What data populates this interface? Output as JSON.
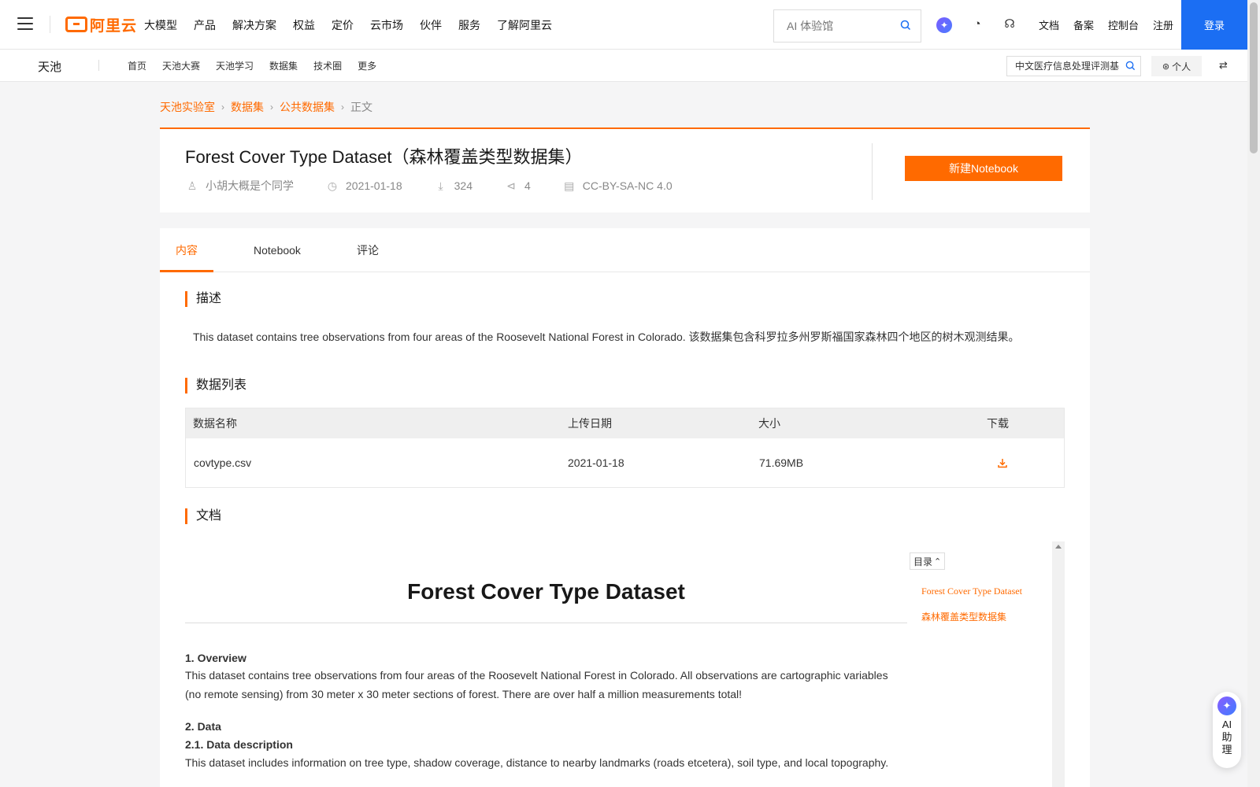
{
  "topnav": {
    "logo_text": "阿里云",
    "items": [
      "大模型",
      "产品",
      "解决方案",
      "权益",
      "定价",
      "云市场",
      "伙伴",
      "服务",
      "了解阿里云"
    ],
    "search_placeholder": "AI 体验馆",
    "util_links": [
      "文档",
      "备案",
      "控制台",
      "注册"
    ],
    "login_label": "登录"
  },
  "subnav": {
    "brand": "天池",
    "items": [
      "首页",
      "天池大赛",
      "天池学习",
      "数据集",
      "技术圈",
      "更多"
    ],
    "search_value": "中文医疗信息处理评测基",
    "personal_label": "个人"
  },
  "breadcrumb": {
    "items": [
      "天池实验室",
      "数据集",
      "公共数据集"
    ],
    "current": "正文"
  },
  "dataset": {
    "title": "Forest Cover Type Dataset（森林覆盖类型数据集）",
    "author": "小胡大概是个同学",
    "date": "2021-01-18",
    "downloads": "324",
    "shares": "4",
    "license": "CC-BY-SA-NC 4.0",
    "new_notebook_label": "新建Notebook"
  },
  "tabs": [
    "内容",
    "Notebook",
    "评论"
  ],
  "sections": {
    "description_title": "描述",
    "description_text": "This dataset contains tree observations from four areas of the Roosevelt National Forest in Colorado. 该数据集包含科罗拉多州罗斯福国家森林四个地区的树木观测结果。",
    "data_list_title": "数据列表",
    "docs_title": "文档"
  },
  "table": {
    "headers": [
      "数据名称",
      "上传日期",
      "大小",
      "下载"
    ],
    "rows": [
      {
        "name": "covtype.csv",
        "date": "2021-01-18",
        "size": "71.69MB"
      }
    ]
  },
  "doc": {
    "h1": "Forest Cover Type Dataset",
    "toc_label": "目录",
    "toc_items": [
      "Forest Cover Type Dataset",
      "森林覆盖类型数据集"
    ],
    "overview_heading": "1. Overview",
    "overview_text": "This dataset contains tree observations from four areas of the Roosevelt National Forest in Colorado. All observations are cartographic variables (no remote sensing) from 30 meter x 30 meter sections of forest. There are over half a million measurements total!",
    "data_heading": "2. Data",
    "data_desc_heading": "2.1. Data description",
    "data_desc_text": "This dataset includes information on tree type, shadow coverage, distance to nearby landmarks (roads etcetera), soil type, and local topography."
  },
  "ai_assistant": {
    "label": "AI助理"
  },
  "colors": {
    "accent": "#ff6a00",
    "login_blue": "#1b6ef3"
  }
}
